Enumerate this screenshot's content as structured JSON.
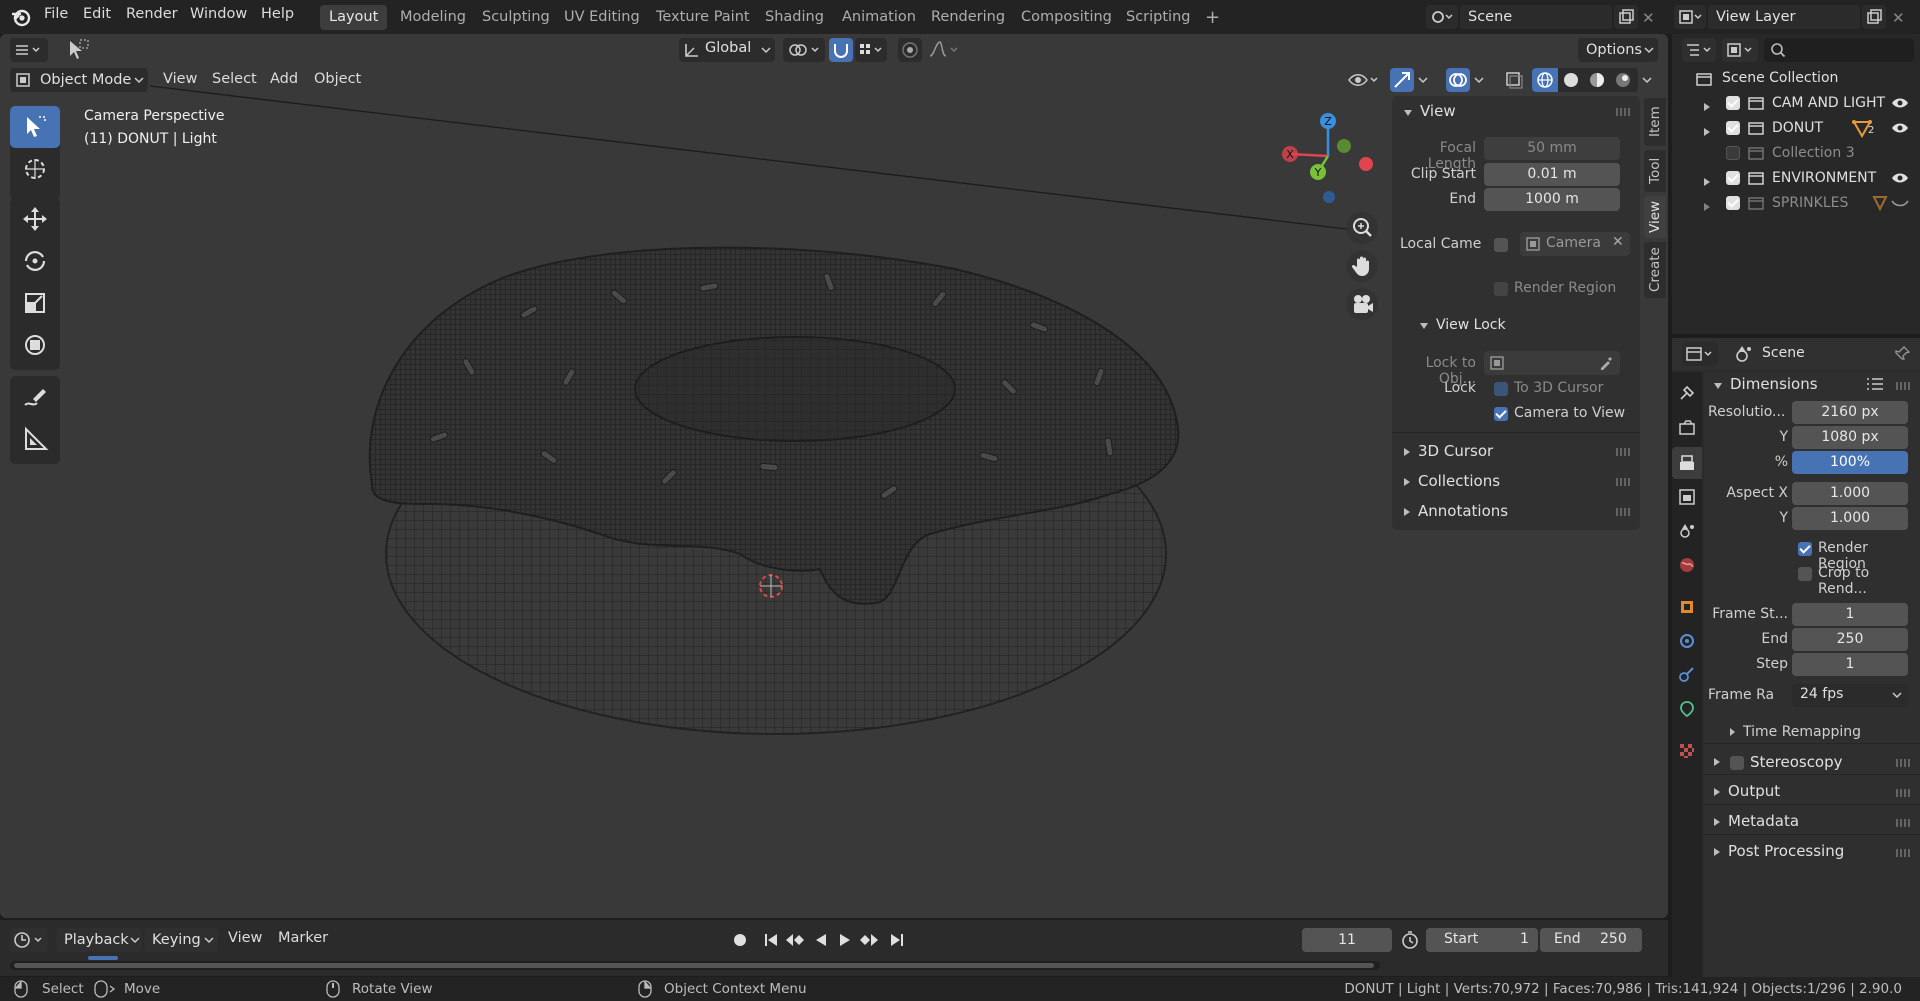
{
  "topbar": {
    "menus": [
      "File",
      "Edit",
      "Render",
      "Window",
      "Help"
    ],
    "workspaces": [
      "Layout",
      "Modeling",
      "Sculpting",
      "UV Editing",
      "Texture Paint",
      "Shading",
      "Animation",
      "Rendering",
      "Compositing",
      "Scripting"
    ],
    "active_workspace": "Layout",
    "add_workspace_label": "+",
    "scene_name": "Scene",
    "view_layer_name": "View Layer"
  },
  "viewport_toolbar": {
    "transform_orientation": "Global",
    "options_label": "Options"
  },
  "viewport_header": {
    "mode": "Object Mode",
    "menus": [
      "View",
      "Select",
      "Add",
      "Object"
    ]
  },
  "viewport_overlay": {
    "line1": "Camera Perspective",
    "line2": "(11) DONUT | Light"
  },
  "gizmo_axes": {
    "z": "Z",
    "x": "X",
    "y": "Y"
  },
  "npanel": {
    "view_header": "View",
    "focal_length_label": "Focal Length",
    "focal_length_value": "50 mm",
    "clip_start_label": "Clip Start",
    "clip_start_value": "0.01 m",
    "clip_end_label": "End",
    "clip_end_value": "1000 m",
    "local_camera_label": "Local Came",
    "local_camera_value": "Camera",
    "render_region_label": "Render Region",
    "view_lock_header": "View Lock",
    "lock_to_object_label": "Lock to Obj...",
    "lock_label": "Lock",
    "to_3d_cursor_label": "To 3D Cursor",
    "camera_to_view_label": "Camera to View",
    "collapsed_sections": [
      "3D Cursor",
      "Collections",
      "Annotations"
    ]
  },
  "sidebar_tabs": [
    "Item",
    "Tool",
    "View",
    "Create"
  ],
  "active_sidebar_tab": "View",
  "outliner": {
    "root": "Scene Collection",
    "items": [
      {
        "name": "CAM AND LIGHT",
        "checked": true,
        "dim": false
      },
      {
        "name": "DONUT",
        "checked": true,
        "dim": false,
        "badge": "2"
      },
      {
        "name": "Collection 3",
        "checked": false,
        "dim": true
      },
      {
        "name": "ENVIRONMENT",
        "checked": true,
        "dim": false
      },
      {
        "name": "SPRINKLES",
        "checked": true,
        "dim": true
      }
    ]
  },
  "properties": {
    "scene_name": "Scene",
    "dimensions_header": "Dimensions",
    "resolution_label": "Resolutio...",
    "resolution_x": "2160 px",
    "y_label": "Y",
    "resolution_y": "1080 px",
    "percent_label": "%",
    "resolution_percent": "100%",
    "aspect_x_label": "Aspect X",
    "aspect_x": "1.000",
    "aspect_y_label": "Y",
    "aspect_y": "1.000",
    "render_region_label": "Render Region",
    "crop_label": "Crop to Rend...",
    "frame_start_label": "Frame St...",
    "frame_start": "1",
    "frame_end_label": "End",
    "frame_end": "250",
    "frame_step_label": "Step",
    "frame_step": "1",
    "frame_rate_label": "Frame Ra",
    "frame_rate": "24 fps",
    "time_remapping_label": "Time Remapping",
    "stereoscopy_label": "Stereoscopy",
    "sections": [
      "Output",
      "Metadata",
      "Post Processing"
    ]
  },
  "timeline": {
    "menus": [
      "Playback",
      "Keying",
      "View",
      "Marker"
    ],
    "current_frame": "11",
    "start_label": "Start",
    "start_value": "1",
    "end_label": "End",
    "end_value": "250"
  },
  "statusbar": {
    "select": "Select",
    "move": "Move",
    "rotate": "Rotate View",
    "context": "Object Context Menu",
    "stats": "DONUT | Light | Verts:70,972 | Faces:70,986 | Tris:141,924 | Objects:1/296 | 2.90.0"
  },
  "colors": {
    "accent": "#4772b3",
    "viewport_bg": "#393939",
    "panel_bg": "#303030",
    "axis_x": "#e0444e",
    "axis_y": "#7ac13a",
    "axis_z": "#3b8fe0"
  }
}
